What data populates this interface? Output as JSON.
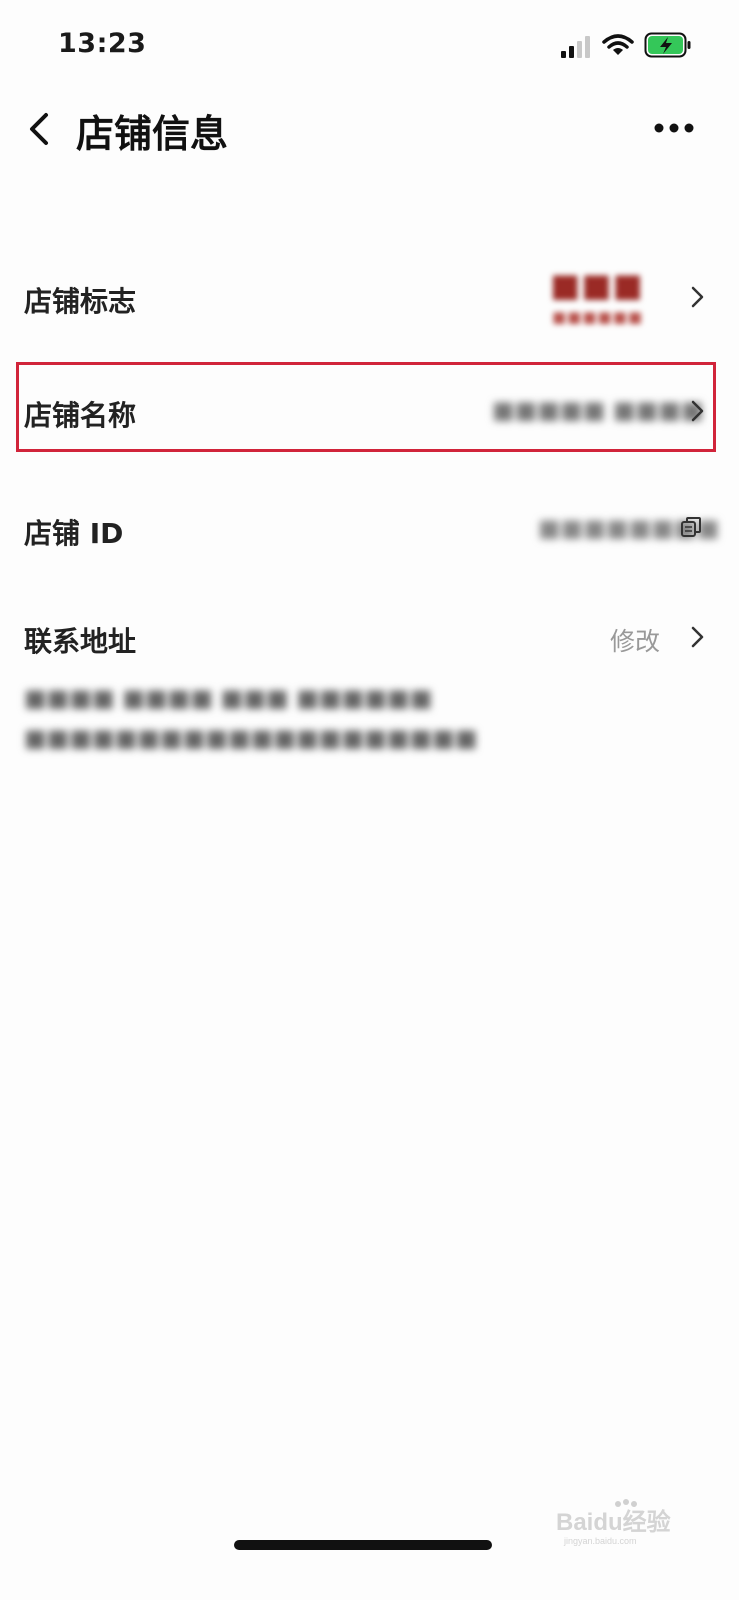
{
  "status_bar": {
    "time": "13:23",
    "signal_icon": "cellular-signal-icon",
    "wifi_icon": "wifi-icon",
    "battery_icon": "battery-charging-icon",
    "battery_color": "#34c759"
  },
  "header": {
    "title": "店铺信息",
    "back_icon": "chevron-left-icon",
    "more_icon": "more-dots-icon"
  },
  "rows": {
    "logo": {
      "label": "店铺标志",
      "logo_text": "■■■",
      "logo_subtext": "■■■■■■"
    },
    "name": {
      "label": "店铺名称",
      "value": "■■■■■ ■■■■",
      "highlight_color": "#d1243a"
    },
    "id": {
      "label": "店铺 ID",
      "value": "■■■■■■■■",
      "copy_icon": "copy-icon"
    },
    "address": {
      "label": "联系地址",
      "edit_label": "修改",
      "lines": [
        "■■■■ ■■■■ ■■■ ■■■■■■",
        "■■■■■■■■■■■■■■■■■■■■"
      ]
    }
  },
  "watermark": {
    "text": "Baidu经验",
    "subtext": "jingyan.baidu.com"
  }
}
